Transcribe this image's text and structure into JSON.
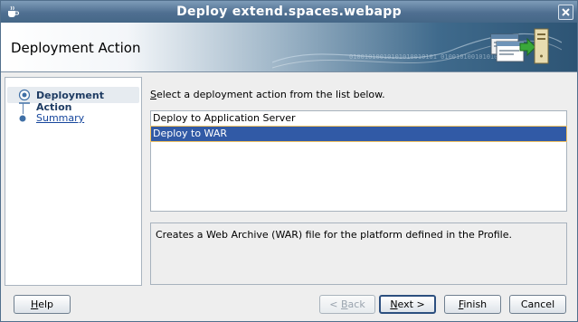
{
  "window": {
    "title": "Deploy extend.spaces.webapp"
  },
  "header": {
    "title": "Deployment Action",
    "binary_pattern": "01001010010101010010101 0100101001010101"
  },
  "nav": {
    "items": [
      {
        "label": "Deployment Action",
        "active": true
      },
      {
        "label": "Summary",
        "active": false
      }
    ]
  },
  "main": {
    "instruction_prefix": "S",
    "instruction_rest": "elect a deployment action from the list below.",
    "actions": [
      "Deploy to Application Server",
      "Deploy to WAR"
    ],
    "selected_index": 1,
    "description": "Creates a Web Archive (WAR) file for the platform defined in the Profile."
  },
  "buttons": {
    "help": {
      "mnemonic": "H",
      "rest": "elp"
    },
    "back": {
      "prefix": "< ",
      "mnemonic": "B",
      "rest": "ack"
    },
    "next": {
      "mnemonic": "N",
      "rest": "ext >"
    },
    "finish": {
      "mnemonic": "F",
      "rest": "inish"
    },
    "cancel": {
      "label": "Cancel"
    }
  },
  "colors": {
    "title_bar": "#4f6f91",
    "selection": "#315aa6",
    "link": "#16469c"
  }
}
